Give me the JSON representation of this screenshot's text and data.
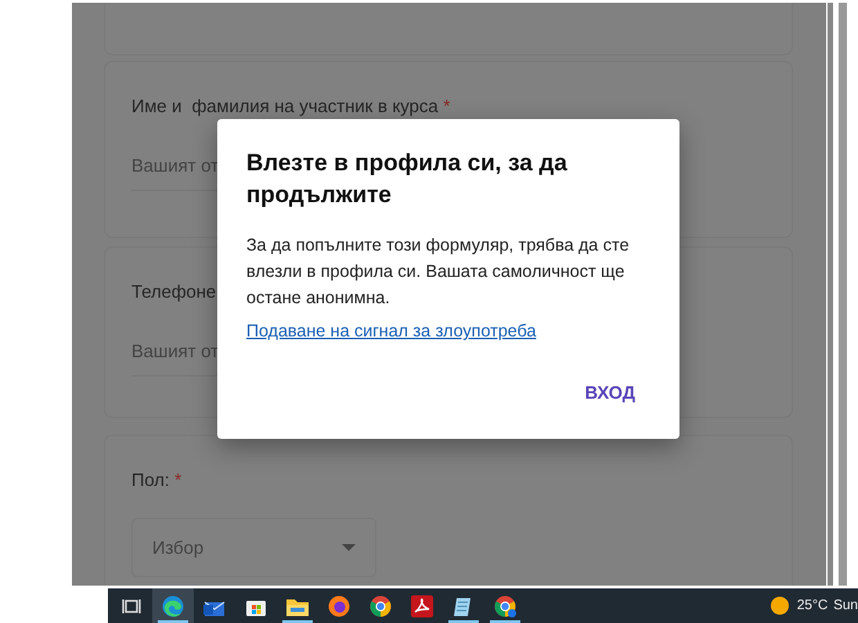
{
  "form": {
    "cards": [
      {
        "kind": "blank"
      },
      {
        "kind": "text",
        "label": "Име и  фамилия на участник в курса",
        "required_mark": "*",
        "placeholder": "Вашият от"
      },
      {
        "kind": "text",
        "label": "Телефоне",
        "placeholder": "Вашият от"
      },
      {
        "kind": "select",
        "label": "Пол:",
        "required_mark": "*",
        "placeholder": "Избор"
      }
    ]
  },
  "dialog": {
    "title": "Влезте в профила си, за да продължите",
    "message": "За да попълните този формуляр, трябва да сте влезли в профила си. Вашата самоличност ще остане анонимна.",
    "link": "Подаване на сигнал за злоупотреба",
    "button": "ВХОД"
  },
  "taskbar": {
    "apps": [
      {
        "kind": "taskview",
        "selected": false,
        "running": false
      },
      {
        "kind": "edge",
        "selected": true,
        "running": true
      },
      {
        "kind": "mail",
        "selected": false,
        "running": false
      },
      {
        "kind": "store",
        "selected": false,
        "running": false
      },
      {
        "kind": "explorer",
        "selected": false,
        "running": true
      },
      {
        "kind": "firefox",
        "selected": false,
        "running": false
      },
      {
        "kind": "chrome",
        "selected": false,
        "running": false
      },
      {
        "kind": "acrobat",
        "selected": false,
        "running": false
      },
      {
        "kind": "notepad",
        "selected": false,
        "running": true
      },
      {
        "kind": "chrome-profile",
        "selected": false,
        "running": true
      }
    ],
    "weather": {
      "temperature": "25°C",
      "text": "Sun"
    }
  }
}
